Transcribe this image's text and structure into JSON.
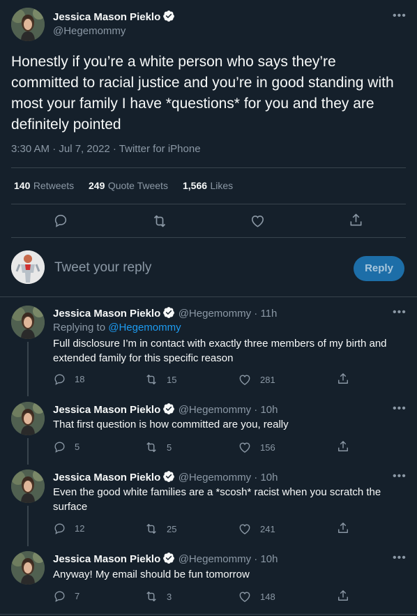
{
  "main_tweet": {
    "author_name": "Jessica Mason Pieklo",
    "author_handle": "@Hegemommy",
    "text": "Honestly if you’re a white person who says they’re committed to racial justice and you’re in good standing with most your family I have *questions* for you and they are definitely pointed",
    "timestamp": "3:30 AM · Jul 7, 2022 · Twitter for iPhone",
    "stats": {
      "retweets_count": "140",
      "retweets_label": "Retweets",
      "quotes_count": "249",
      "quotes_label": "Quote Tweets",
      "likes_count": "1,566",
      "likes_label": "Likes"
    }
  },
  "composer": {
    "placeholder": "Tweet your reply",
    "button_label": "Reply"
  },
  "replies": [
    {
      "author_name": "Jessica Mason Pieklo",
      "handle_time": "@Hegemommy · 11h",
      "replying_prefix": "Replying to ",
      "replying_to": "@Hegemommy",
      "text": "Full disclosure I’m in contact with exactly three members of my birth and extended family for this specific reason",
      "replies": "18",
      "retweets": "15",
      "likes": "281"
    },
    {
      "author_name": "Jessica Mason Pieklo",
      "handle_time": "@Hegemommy · 10h",
      "text": "That first question is how committed are you, really",
      "replies": "5",
      "retweets": "5",
      "likes": "156"
    },
    {
      "author_name": "Jessica Mason Pieklo",
      "handle_time": "@Hegemommy · 10h",
      "text": "Even the good white families are a *scosh* racist when you scratch the surface",
      "replies": "12",
      "retweets": "25",
      "likes": "241"
    },
    {
      "author_name": "Jessica Mason Pieklo",
      "handle_time": "@Hegemommy · 10h",
      "text": "Anyway! My email should be fun tomorrow",
      "replies": "7",
      "retweets": "3",
      "likes": "148"
    }
  ],
  "icons": {
    "more": "more-icon",
    "verified": "verified-badge-icon",
    "reply": "reply-icon",
    "retweet": "retweet-icon",
    "like": "heart-icon",
    "share": "share-icon"
  },
  "colors": {
    "background": "#15202b",
    "accent": "#1d9bf0",
    "muted": "#8b98a5",
    "divider": "#38444d"
  }
}
